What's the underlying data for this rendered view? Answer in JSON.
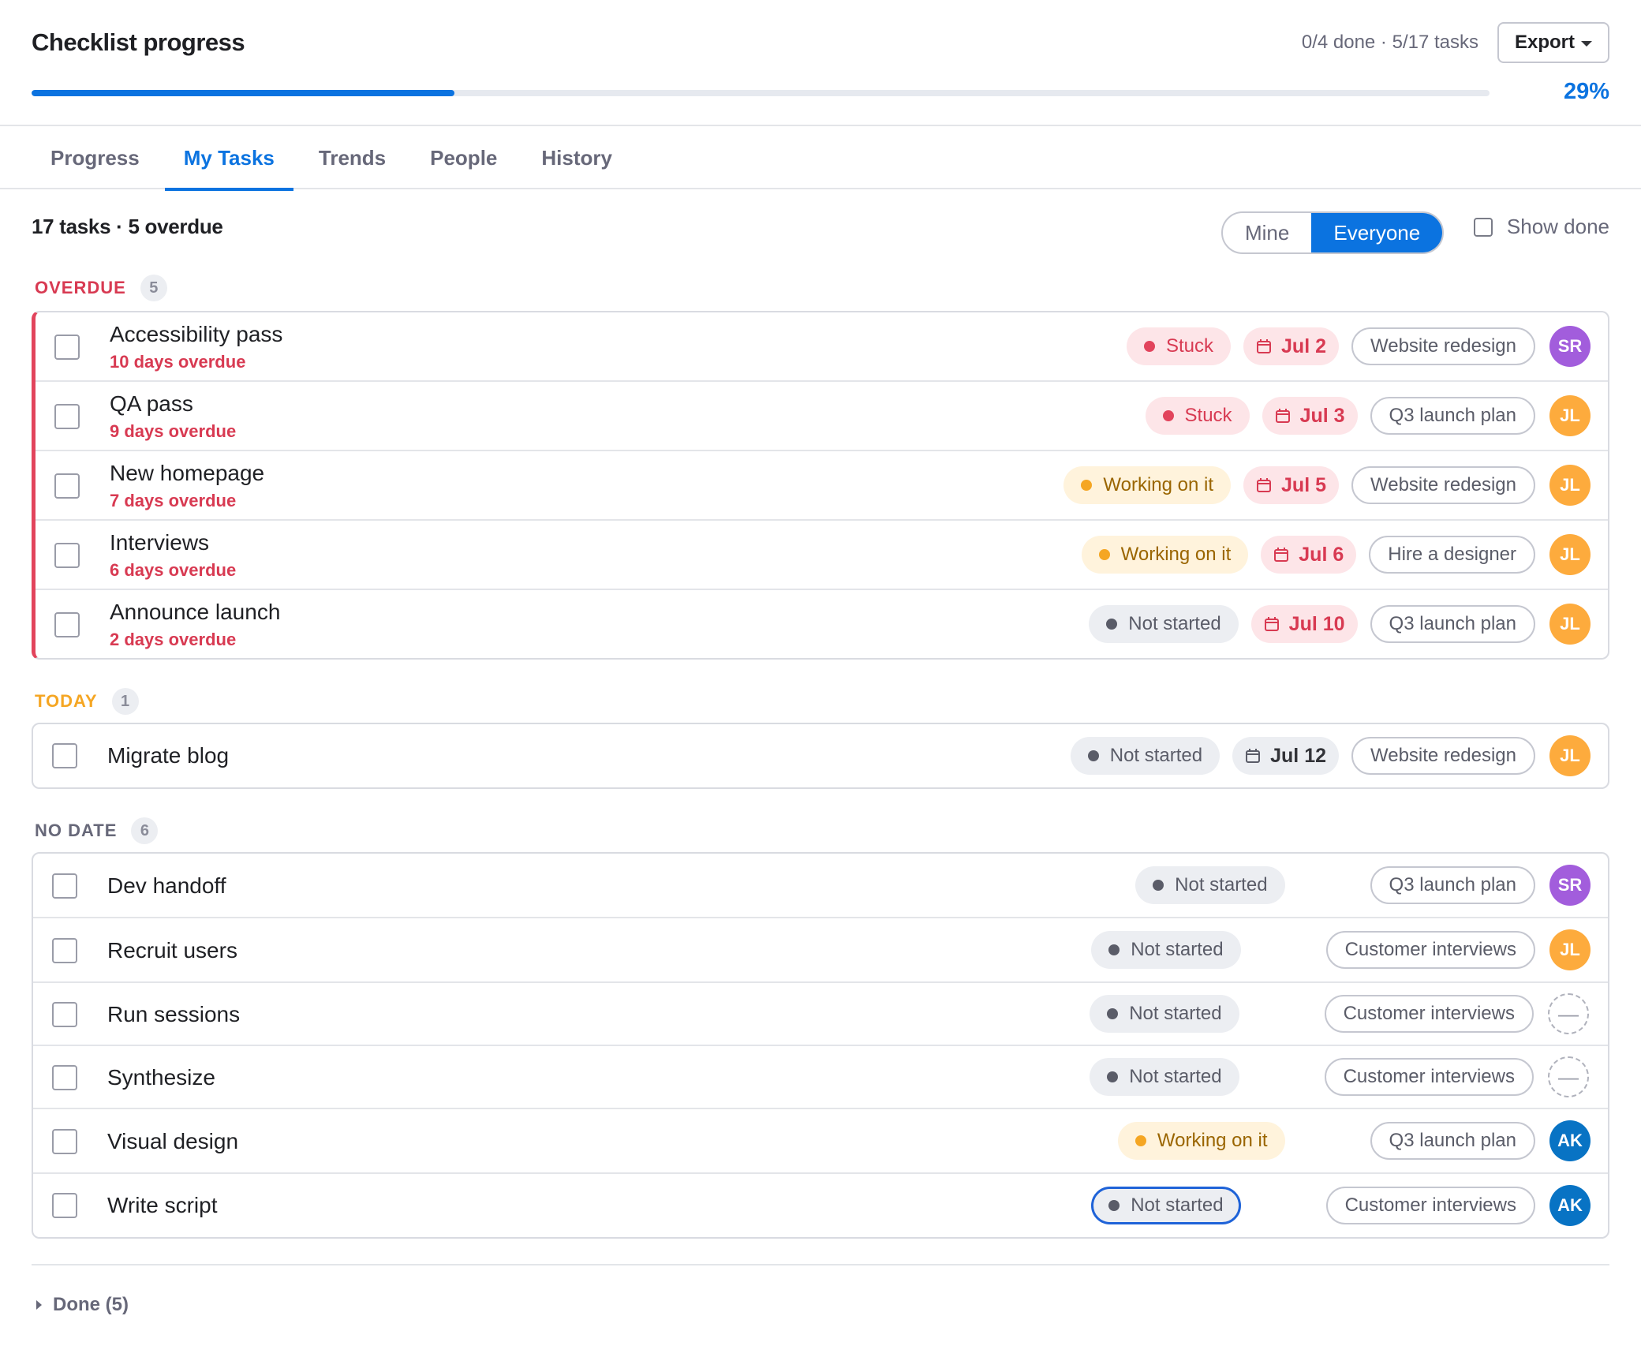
{
  "header": {
    "title": "Checklist progress",
    "summary": "0/4 done · 5/17 tasks",
    "export_label": "Export",
    "progress_percent_label": "29%",
    "progress_fraction": 0.29
  },
  "tabs": [
    {
      "label": "Progress",
      "active": false
    },
    {
      "label": "My Tasks",
      "active": true
    },
    {
      "label": "Trends",
      "active": false
    },
    {
      "label": "People",
      "active": false
    },
    {
      "label": "History",
      "active": false
    }
  ],
  "toolbar": {
    "counts": "17 tasks · 5 overdue",
    "filter_mine": "Mine",
    "filter_everyone": "Everyone",
    "filter_selected": "Everyone",
    "show_done_label": "Show done",
    "show_done_checked": false
  },
  "colors": {
    "accent": "#0b73e0",
    "overdue": "#d83a52",
    "today": "#f5a623",
    "stuck": "#e2445c",
    "working": "#f5a623",
    "not_started": "#5a5c68"
  },
  "groups": {
    "overdue": {
      "label": "OVERDUE",
      "count": "5",
      "tasks": [
        {
          "name": "Accessibility pass",
          "sub": "10 days overdue",
          "status": "Stuck",
          "date": "Jul 2",
          "project": "Website redesign",
          "assignee": "SR"
        },
        {
          "name": "QA pass",
          "sub": "9 days overdue",
          "status": "Stuck",
          "date": "Jul 3",
          "project": "Q3 launch plan",
          "assignee": "JL"
        },
        {
          "name": "New homepage",
          "sub": "7 days overdue",
          "status": "Working on it",
          "date": "Jul 5",
          "project": "Website redesign",
          "assignee": "JL"
        },
        {
          "name": "Interviews",
          "sub": "6 days overdue",
          "status": "Working on it",
          "date": "Jul 6",
          "project": "Hire a designer",
          "assignee": "JL"
        },
        {
          "name": "Announce launch",
          "sub": "2 days overdue",
          "status": "Not started",
          "date": "Jul 10",
          "project": "Q3 launch plan",
          "assignee": "JL"
        }
      ]
    },
    "today": {
      "label": "TODAY",
      "count": "1",
      "tasks": [
        {
          "name": "Migrate blog",
          "status": "Not started",
          "date": "Jul 12",
          "project": "Website redesign",
          "assignee": "JL"
        }
      ]
    },
    "no_date": {
      "label": "NO DATE",
      "count": "6",
      "tasks": [
        {
          "name": "Dev handoff",
          "status": "Not started",
          "project": "Q3 launch plan",
          "assignee": "SR"
        },
        {
          "name": "Recruit users",
          "status": "Not started",
          "project": "Customer interviews",
          "assignee": "JL"
        },
        {
          "name": "Run sessions",
          "status": "Not started",
          "project": "Customer interviews",
          "assignee": "—"
        },
        {
          "name": "Synthesize",
          "status": "Not started",
          "project": "Customer interviews",
          "assignee": "—"
        },
        {
          "name": "Visual design",
          "status": "Working on it",
          "project": "Q3 launch plan",
          "assignee": "AK"
        },
        {
          "name": "Write script",
          "status": "Not started",
          "project": "Customer interviews",
          "assignee": "AK"
        }
      ]
    }
  },
  "done_toggle": "Done (5)",
  "icons": {
    "calendar": "calendar-icon",
    "caret": "caret-down-icon",
    "expand": "triangle-right-icon",
    "unassigned": "unassigned-avatar-icon"
  }
}
